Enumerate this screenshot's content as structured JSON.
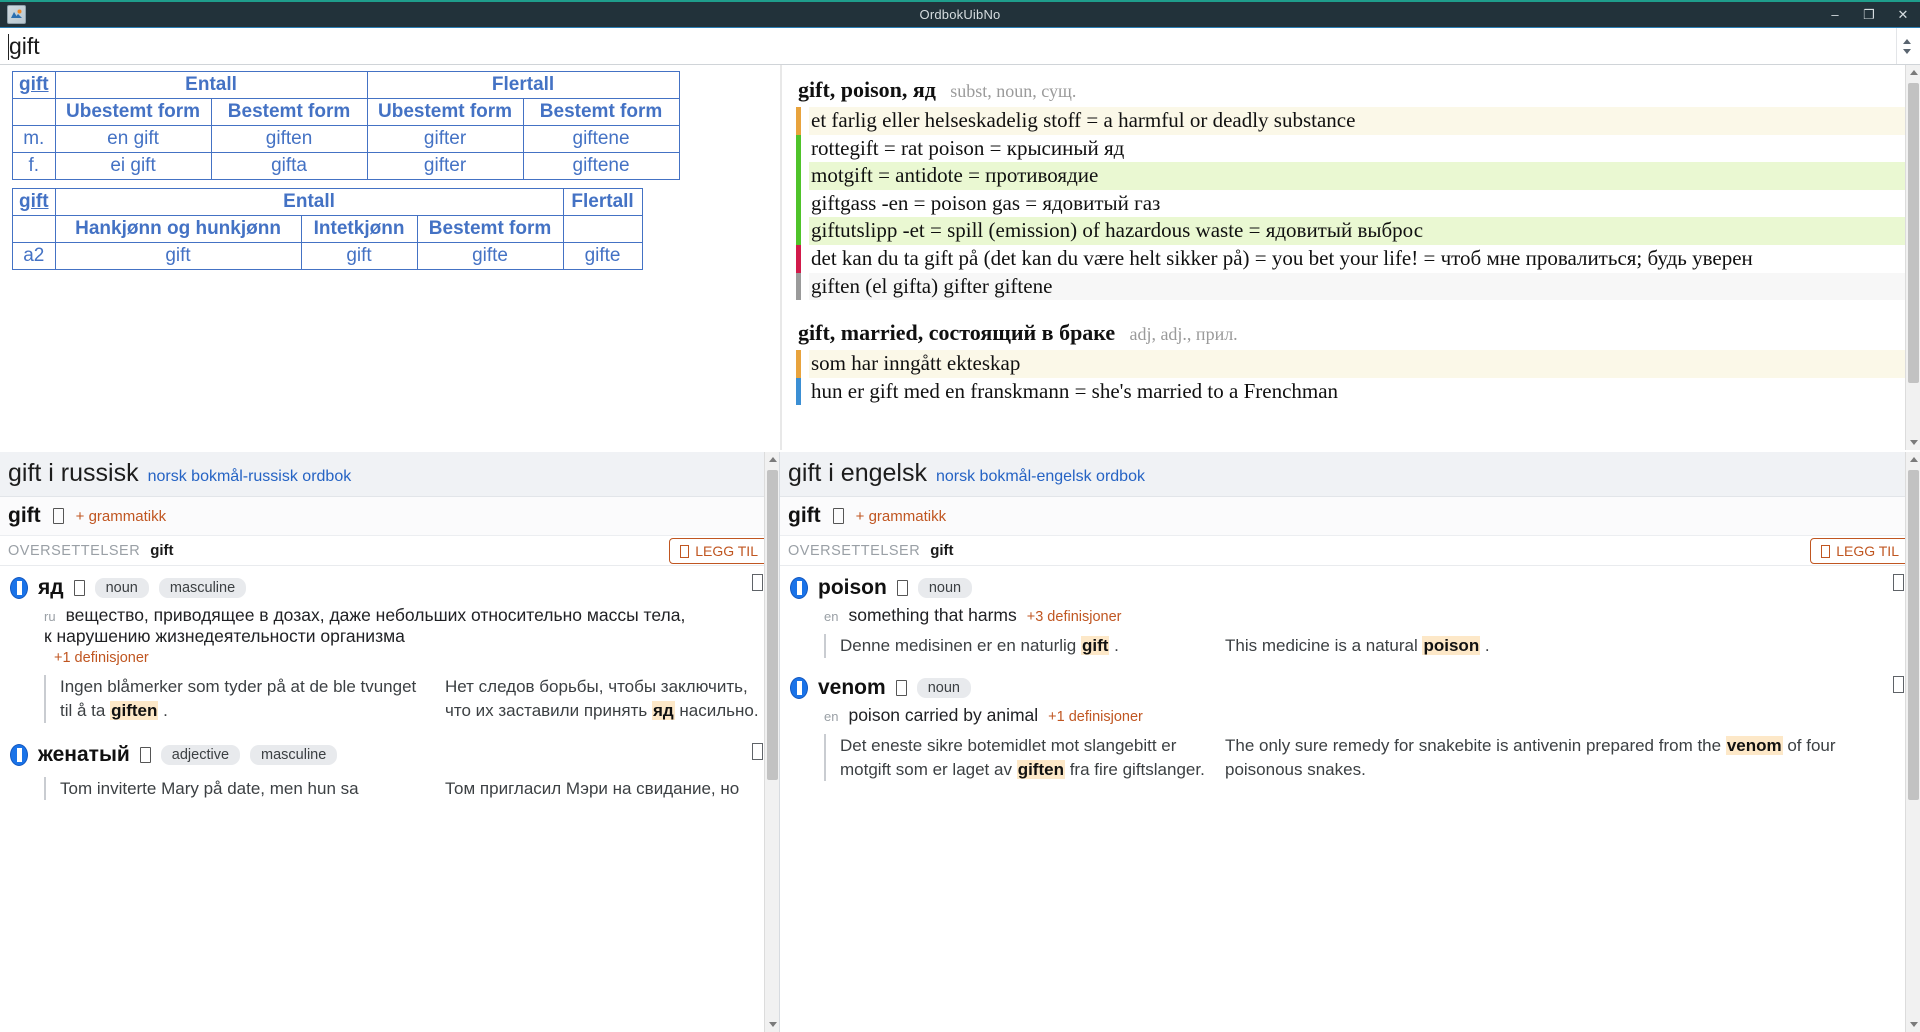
{
  "window": {
    "title": "OrdbokUibNo",
    "icon": "app-icon",
    "minimize": "–",
    "maximize": "❐",
    "close": "✕"
  },
  "search": {
    "value": "gift",
    "placeholder": ""
  },
  "inflection_tables": [
    {
      "lemma": "gift",
      "group_headers": [
        "Entall",
        "Flertall"
      ],
      "sub_headers": [
        "Ubestemt form",
        "Bestemt form",
        "Ubestemt form",
        "Bestemt form"
      ],
      "rows": [
        {
          "label": "m.",
          "cells": [
            "en gift",
            "giften",
            "gifter",
            "giftene"
          ]
        },
        {
          "label": "f.",
          "cells": [
            "ei gift",
            "gifta",
            "gifter",
            "giftene"
          ]
        }
      ]
    },
    {
      "lemma": "gift",
      "group_headers": [
        "Entall",
        "Flertall"
      ],
      "sub_headers": [
        "Hankjønn og hunkjønn",
        "Intetkjønn",
        "Bestemt form",
        ""
      ],
      "rows": [
        {
          "label": "a2",
          "cells": [
            "gift",
            "gift",
            "gifte",
            "gifte"
          ]
        }
      ]
    }
  ],
  "article": {
    "entries": [
      {
        "lemma": "gift, poison, яд",
        "pos": "subst, noun, сущ.",
        "senses": [
          {
            "bar": "#e8a33d",
            "bg": "#fbf8e8",
            "text": "et farlig eller helseskadelig stoff = a harmful or deadly substance"
          },
          {
            "bar": "#4fc32a",
            "bg": "#ffffff",
            "text": "rottegift = rat poison = крысиный яд"
          },
          {
            "bar": "#4fc32a",
            "bg": "#eaf8d2",
            "text": "motgift = antidote = противоядие"
          },
          {
            "bar": "#4fc32a",
            "bg": "#ffffff",
            "text": "giftgass -en = poison gas = ядовитый газ"
          },
          {
            "bar": "#4fc32a",
            "bg": "#eaf8d2",
            "text": "giftutslipp -et = spill (emission) of hazardous waste = ядовитый выброс"
          },
          {
            "bar": "#d11a4a",
            "bg": "#ffffff",
            "text": "det kan du ta gift på (det kan du være helt sikker på) = you bet your life! = чтоб мне провалиться; будь уверен"
          },
          {
            "bar": "#9a9a9a",
            "bg": "#f7f7f7",
            "text": "giften (el gifta) gifter giftene"
          }
        ]
      },
      {
        "lemma": "gift, married, состоящий в браке",
        "pos": "adj, adj., прил.",
        "senses": [
          {
            "bar": "#e8a33d",
            "bg": "#fbf8e8",
            "text": "som har inngått ekteskap"
          },
          {
            "bar": "#3b8fd4",
            "bg": "#ffffff",
            "text": "hun er gift med en franskmann = she's married to a Frenchman"
          }
        ]
      }
    ]
  },
  "panels": [
    {
      "id": "russian",
      "title_main": "gift i russisk",
      "title_sub": "norsk bokmål-russisk ordbok",
      "lemma": "gift",
      "audio_icon": "speaker-icon",
      "grammatikk": "+ grammatikk",
      "translations_label": "OVERSETTELSER",
      "translations_word": "gift",
      "add_button": "LEGG TIL",
      "senses": [
        {
          "word": "яд",
          "tags": [
            "noun",
            "masculine"
          ],
          "lang": "ru",
          "definition": "вещество, приводящее в дозах, даже небольших относительно массы тела,",
          "definition_cont": "к нарушению жизнедеятельности организма",
          "more": "+1 definisjoner",
          "example_src": [
            "Ingen blåmerker som tyder på at de ble tvunget til å ta ",
            "giften",
            " ."
          ],
          "example_tgt": [
            "Нет следов борьбы, чтобы заключить, что их заставили принять ",
            "яд",
            " насильно."
          ]
        },
        {
          "word": "женатый",
          "tags": [
            "adjective",
            "masculine"
          ],
          "example_src": [
            "Tom inviterte Mary på date, men hun sa"
          ],
          "example_tgt": [
            "Том пригласил Мэри на свидание, но"
          ]
        }
      ]
    },
    {
      "id": "english",
      "title_main": "gift i engelsk",
      "title_sub": "norsk bokmål-engelsk ordbok",
      "lemma": "gift",
      "audio_icon": "speaker-icon",
      "grammatikk": "+ grammatikk",
      "translations_label": "OVERSETTELSER",
      "translations_word": "gift",
      "add_button": "LEGG TIL",
      "senses": [
        {
          "word": "poison",
          "tags": [
            "noun"
          ],
          "lang": "en",
          "definition": "something that harms",
          "more": "+3 definisjoner",
          "example_src": [
            "Denne medisinen er en naturlig ",
            "gift",
            " ."
          ],
          "example_tgt": [
            "This medicine is a natural ",
            "poison",
            " ."
          ]
        },
        {
          "word": "venom",
          "tags": [
            "noun"
          ],
          "lang": "en",
          "definition": "poison carried by animal",
          "more": "+1 definisjoner",
          "example_src": [
            "Det eneste sikre botemidlet mot slangebitt er motgift som er laget av ",
            "giften",
            " fra fire giftslanger."
          ],
          "example_tgt": [
            "The only sure remedy for snakebite is antivenin prepared from the ",
            "venom",
            " of four poisonous snakes."
          ]
        }
      ]
    }
  ],
  "colors": {
    "titlebar": "#22323a",
    "accent_top": "#1f9e8c",
    "table_blue": "#4472c4",
    "link_blue": "#2563c4",
    "orange": "#c05621",
    "highlight": "#fde8c8",
    "flag_blue": "#1a73e8"
  }
}
